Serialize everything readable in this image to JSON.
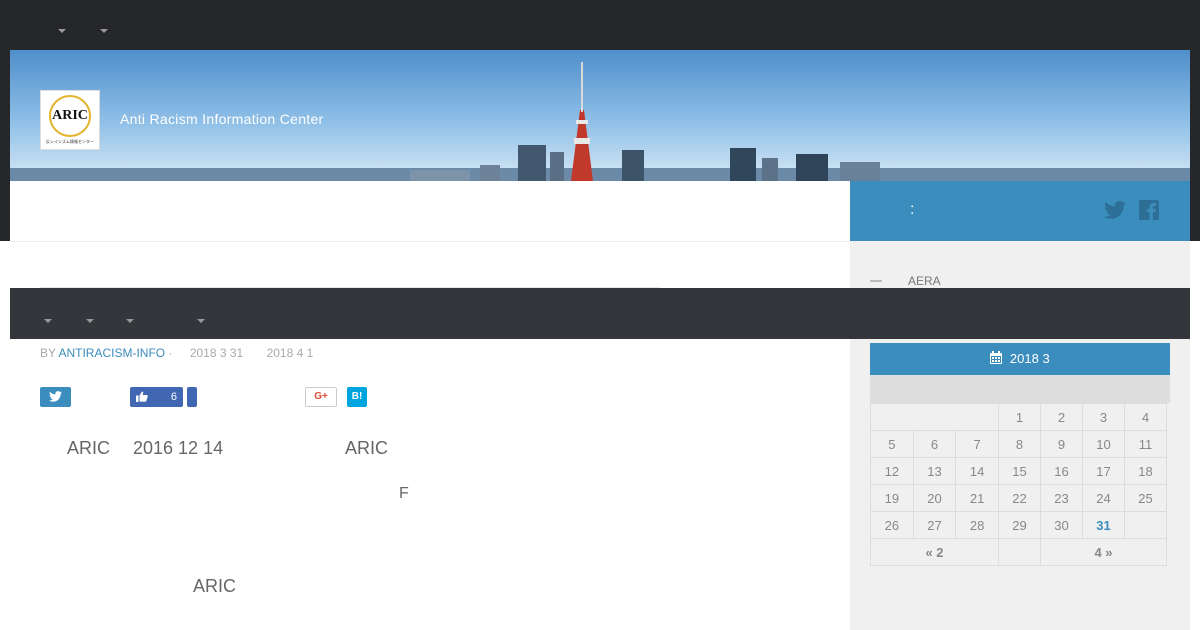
{
  "header": {
    "logo_text": "ARIC",
    "logo_subtext": "反レイシズム情報センター",
    "site_description": "Anti Racism Information Center"
  },
  "social": {
    "colon": ":",
    "twitter_icon": "twitter-icon",
    "facebook_icon": "facebook-icon"
  },
  "sidebar": {
    "recent_item": "AERA"
  },
  "post_meta": {
    "by": "BY",
    "author": "ANTIRACISM-INFO",
    "separator": "·",
    "published": "2018 3 31",
    "updated": "2018 4 1"
  },
  "share": {
    "like_count": "6",
    "google_label": "G+",
    "hatena_label": "B!"
  },
  "content": {
    "line1_a": "ARIC",
    "line1_b": "2016 12 14",
    "line1_c": "ARIC",
    "line2": "F",
    "line3": "ARIC"
  },
  "calendar": {
    "title": "2018 3",
    "weeks": [
      [
        "",
        "",
        "",
        "1",
        "2",
        "3",
        "4"
      ],
      [
        "5",
        "6",
        "7",
        "8",
        "9",
        "10",
        "11"
      ],
      [
        "12",
        "13",
        "14",
        "15",
        "16",
        "17",
        "18"
      ],
      [
        "19",
        "20",
        "21",
        "22",
        "23",
        "24",
        "25"
      ],
      [
        "26",
        "27",
        "28",
        "29",
        "30",
        "31",
        ""
      ]
    ],
    "today": "31",
    "prev_label": "« 2",
    "next_label": "4 »"
  },
  "colors": {
    "accent": "#3b8dbd",
    "dark": "#26272b",
    "nav": "#33363b"
  }
}
